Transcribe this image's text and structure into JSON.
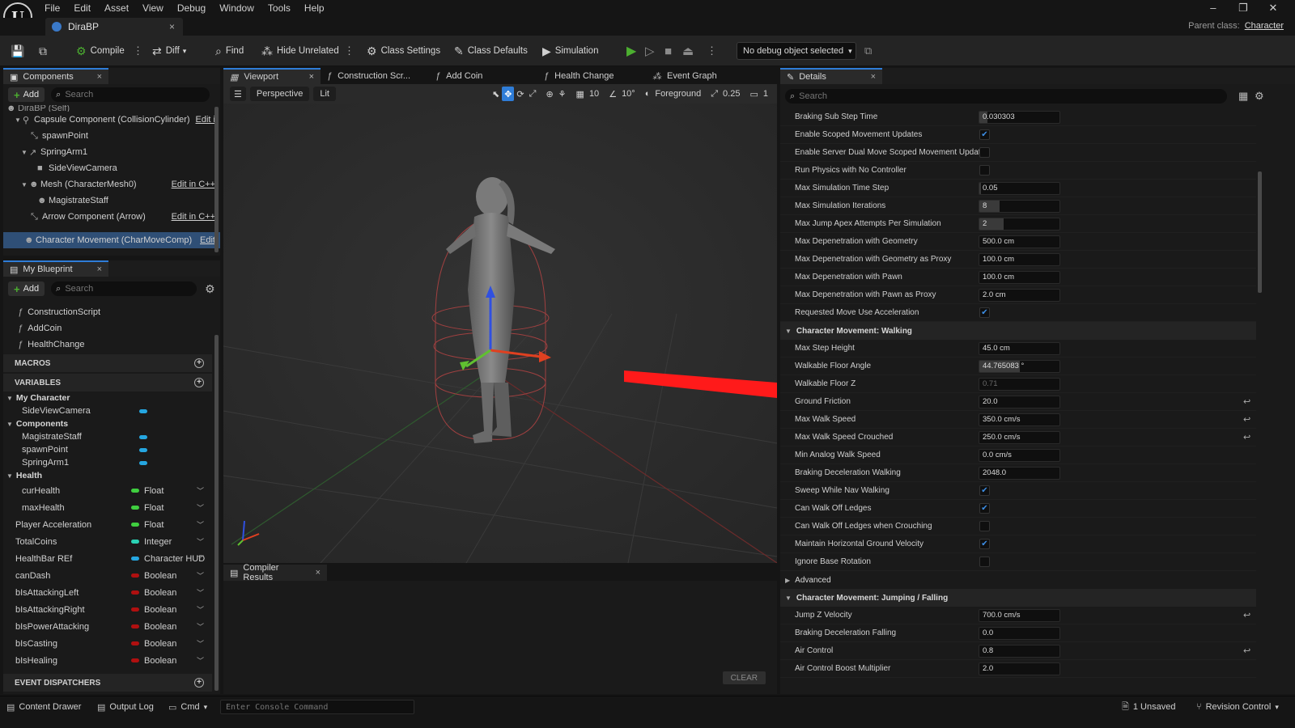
{
  "menu": {
    "logo": "U",
    "items": [
      "File",
      "Edit",
      "Asset",
      "View",
      "Debug",
      "Window",
      "Tools",
      "Help"
    ]
  },
  "window_controls": [
    "–",
    "❐",
    "✕"
  ],
  "doc_tab": {
    "title": "DiraBP",
    "close": "×"
  },
  "parent_class": {
    "label": "Parent class:",
    "value": "Character"
  },
  "toolbar": {
    "compile": "Compile",
    "diff": "Diff",
    "find": "Find",
    "hide_unrelated": "Hide Unrelated",
    "class_settings": "Class Settings",
    "class_defaults": "Class Defaults",
    "simulation": "Simulation",
    "debug_object": "No debug object selected"
  },
  "components": {
    "tab": "Components",
    "close": "×",
    "add": "Add",
    "search_placeholder": "Search",
    "items": [
      {
        "label": "DiraBP (Self)",
        "indent": 4,
        "icon": "☻",
        "arrow": ""
      },
      {
        "label": "Capsule Component (CollisionCylinder)",
        "indent": 14,
        "icon": "⚲",
        "arrow": "▼",
        "edit": "Edit i"
      },
      {
        "label": "spawnPoint",
        "indent": 30,
        "icon": "⤡",
        "arrow": ""
      },
      {
        "label": "SpringArm1",
        "indent": 22,
        "icon": "↗",
        "arrow": "▼"
      },
      {
        "label": "SideViewCamera",
        "indent": 38,
        "icon": "■",
        "arrow": ""
      },
      {
        "label": "Mesh (CharacterMesh0)",
        "indent": 22,
        "icon": "☻",
        "arrow": "▼",
        "edit": "Edit in C++"
      },
      {
        "label": "MagistrateStaff",
        "indent": 38,
        "icon": "☻",
        "arrow": ""
      },
      {
        "label": "Arrow Component (Arrow)",
        "indent": 30,
        "icon": "⤡",
        "arrow": "",
        "edit": "Edit in C++"
      },
      {
        "label": "Character Movement (CharMoveComp)",
        "indent": 22,
        "icon": "☻",
        "arrow": "",
        "edit": "Edit",
        "selected": true
      }
    ]
  },
  "my_blueprint": {
    "tab": "My Blueprint",
    "close": "×",
    "add": "Add",
    "search_placeholder": "Search",
    "functions": [
      "ConstructionScript",
      "AddCoin",
      "HealthChange"
    ],
    "macros": "MACROS",
    "variables": "VARIABLES",
    "event_dispatchers": "EVENT DISPATCHERS",
    "cat_my_character": "My Character",
    "cat_components": "Components",
    "cat_health": "Health",
    "my_character_vars": [
      "SideViewCamera"
    ],
    "component_vars": [
      "MagistrateStaff",
      "spawnPoint",
      "SpringArm1"
    ],
    "health_vars": [
      {
        "name": "curHealth",
        "type": "Float",
        "color": "#3fce3f"
      },
      {
        "name": "maxHealth",
        "type": "Float",
        "color": "#3fce3f"
      }
    ],
    "other_vars": [
      {
        "name": "Player Acceleration",
        "type": "Float",
        "color": "#3fce3f"
      },
      {
        "name": "TotalCoins",
        "type": "Integer",
        "color": "#2ad1b4"
      },
      {
        "name": "HealthBar REf",
        "type": "Character HUD",
        "color": "#25a6e0"
      },
      {
        "name": "canDash",
        "type": "Boolean",
        "color": "#b01010"
      },
      {
        "name": "bIsAttackingLeft",
        "type": "Boolean",
        "color": "#b01010"
      },
      {
        "name": "bIsAttackingRight",
        "type": "Boolean",
        "color": "#b01010"
      },
      {
        "name": "bIsPowerAttacking",
        "type": "Boolean",
        "color": "#b01010"
      },
      {
        "name": "bIsCasting",
        "type": "Boolean",
        "color": "#b01010"
      },
      {
        "name": "bIsHealing",
        "type": "Boolean",
        "color": "#b01010"
      }
    ]
  },
  "viewport": {
    "tabs": [
      {
        "label": "Viewport",
        "icon": "▦",
        "active": true
      },
      {
        "label": "Construction Scr...",
        "icon": "ƒ"
      },
      {
        "label": "Add Coin",
        "icon": "ƒ"
      },
      {
        "label": "Health Change",
        "icon": "ƒ"
      },
      {
        "label": "Event Graph",
        "icon": "⁂"
      }
    ],
    "close": "×",
    "perspective": "Perspective",
    "lit": "Lit",
    "grid_size": "10",
    "rotation_snap": "10°",
    "foreground": "Foreground",
    "scale_snap": "0.25",
    "camera_speed": "1"
  },
  "compiler": {
    "tab": "Compiler Results",
    "close": "×",
    "clear": "CLEAR"
  },
  "details": {
    "tab": "Details",
    "close": "×",
    "search_placeholder": "Search",
    "rows": [
      {
        "label": "Braking Sub Step Time",
        "value": "0.030303",
        "fill": 0.1
      },
      {
        "label": "Enable Scoped Movement Updates",
        "check": true
      },
      {
        "label": "Enable Server Dual Move Scoped Movement Updat...",
        "check": false
      },
      {
        "label": "Run Physics with No Controller",
        "check": false
      },
      {
        "label": "Max Simulation Time Step",
        "value": "0.05",
        "fill": 0.02
      },
      {
        "label": "Max Simulation Iterations",
        "value": "8",
        "fill": 0.25
      },
      {
        "label": "Max Jump Apex Attempts Per Simulation",
        "value": "2",
        "fill": 0.3
      },
      {
        "label": "Max Depenetration with Geometry",
        "value": "500.0 cm"
      },
      {
        "label": "Max Depenetration with Geometry as Proxy",
        "value": "100.0 cm"
      },
      {
        "label": "Max Depenetration with Pawn",
        "value": "100.0 cm"
      },
      {
        "label": "Max Depenetration with Pawn as Proxy",
        "value": "2.0 cm"
      },
      {
        "label": "Requested Move Use Acceleration",
        "check": true
      },
      {
        "section": "Character Movement: Walking"
      },
      {
        "label": "Max Step Height",
        "value": "45.0 cm"
      },
      {
        "label": "Walkable Floor Angle",
        "value": "44.765083 °",
        "fill": 0.5
      },
      {
        "label": "Walkable Floor Z",
        "value": "0.71",
        "dim": true
      },
      {
        "label": "Ground Friction",
        "value": "20.0",
        "reset": true
      },
      {
        "label": "Max Walk Speed",
        "value": "350.0 cm/s",
        "reset": true
      },
      {
        "label": "Max Walk Speed Crouched",
        "value": "250.0 cm/s",
        "reset": true
      },
      {
        "label": "Min Analog Walk Speed",
        "value": "0.0 cm/s"
      },
      {
        "label": "Braking Deceleration Walking",
        "value": "2048.0"
      },
      {
        "label": "Sweep While Nav Walking",
        "check": true
      },
      {
        "label": "Can Walk Off Ledges",
        "check": true
      },
      {
        "label": "Can Walk Off Ledges when Crouching",
        "check": false
      },
      {
        "label": "Maintain Horizontal Ground Velocity",
        "check": true
      },
      {
        "label": "Ignore Base Rotation",
        "check": false
      },
      {
        "section": "Advanced",
        "collapsed": true,
        "plain": true
      },
      {
        "section": "Character Movement: Jumping / Falling"
      },
      {
        "label": "Jump Z Velocity",
        "value": "700.0 cm/s",
        "reset": true
      },
      {
        "label": "Braking Deceleration Falling",
        "value": "0.0"
      },
      {
        "label": "Air Control",
        "value": "0.8",
        "reset": true
      },
      {
        "label": "Air Control Boost Multiplier",
        "value": "2.0"
      }
    ]
  },
  "statusbar": {
    "content_drawer": "Content Drawer",
    "output_log": "Output Log",
    "cmd": "Cmd",
    "console_placeholder": "Enter Console Command",
    "unsaved": "1 Unsaved",
    "revision_control": "Revision Control"
  }
}
